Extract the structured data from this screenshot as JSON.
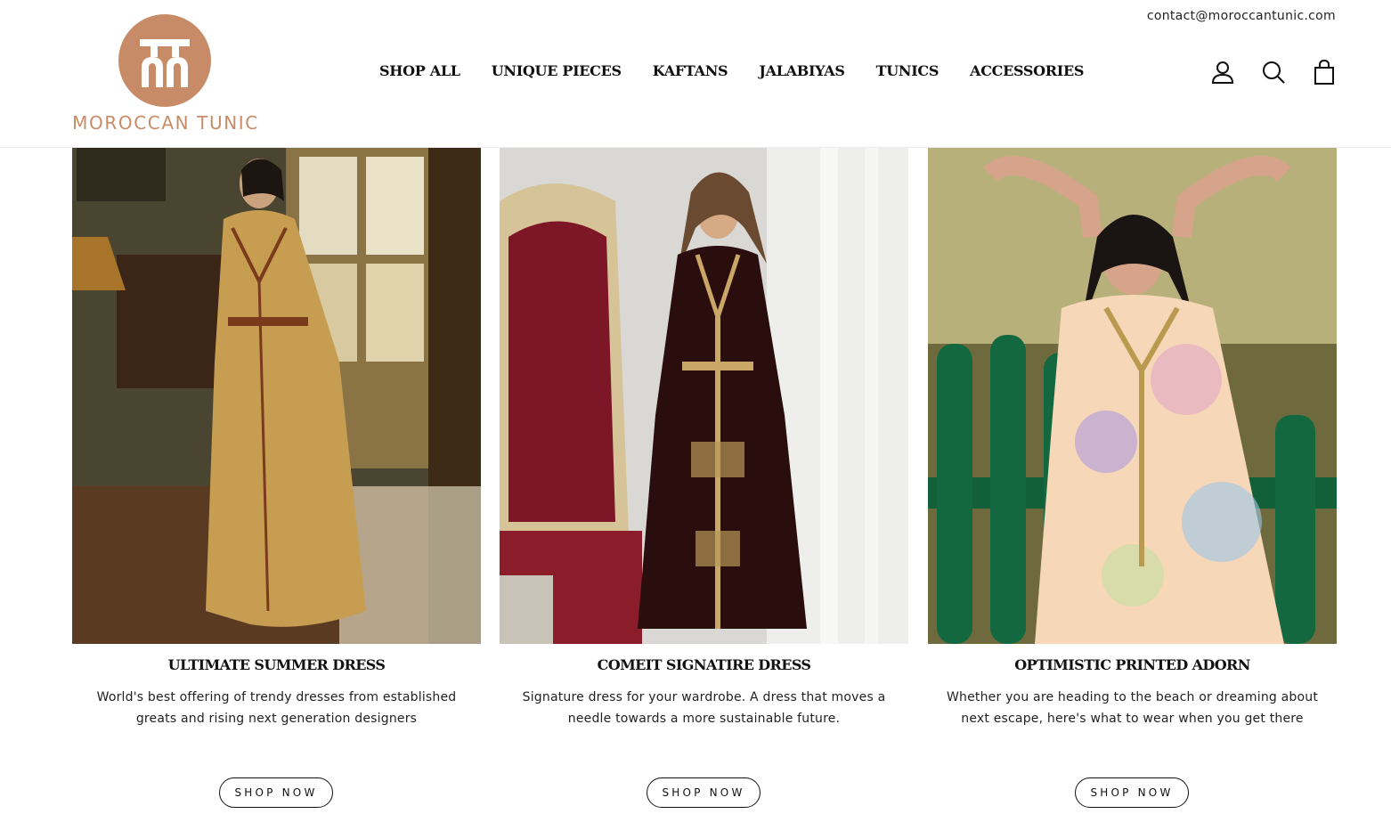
{
  "header": {
    "contact_email": "contact@moroccantunic.com",
    "logo_text": "MOROCCAN TUNIC",
    "nav": [
      {
        "label": "SHOP ALL"
      },
      {
        "label": "UNIQUE PIECES"
      },
      {
        "label": "KAFTANS"
      },
      {
        "label": "JALABIYAS"
      },
      {
        "label": "TUNICS"
      },
      {
        "label": "ACCESSORIES"
      }
    ],
    "icons": [
      "account-icon",
      "search-icon",
      "cart-icon"
    ]
  },
  "colors": {
    "brand": "#c78c67",
    "text": "#111111",
    "background": "#ffffff"
  },
  "products": [
    {
      "title": "ULTIMATE SUMMER DRESS",
      "description": "World's best offering of trendy dresses from established greats and rising next generation designers",
      "button": "SHOP NOW",
      "image": "model-gold-kaftan-photo"
    },
    {
      "title": "COMEIT SIGNATIRE DRESS",
      "description": "Signature dress for your wardrobe. A dress that moves a needle towards a more sustainable future.",
      "button": "SHOP NOW",
      "image": "model-velvet-dress-photo"
    },
    {
      "title": "OPTIMISTIC PRINTED ADORN",
      "description": "Whether you are heading to the beach or dreaming about next escape, here's what to wear when you get there",
      "button": "SHOP NOW",
      "image": "model-printed-tunic-photo"
    }
  ]
}
